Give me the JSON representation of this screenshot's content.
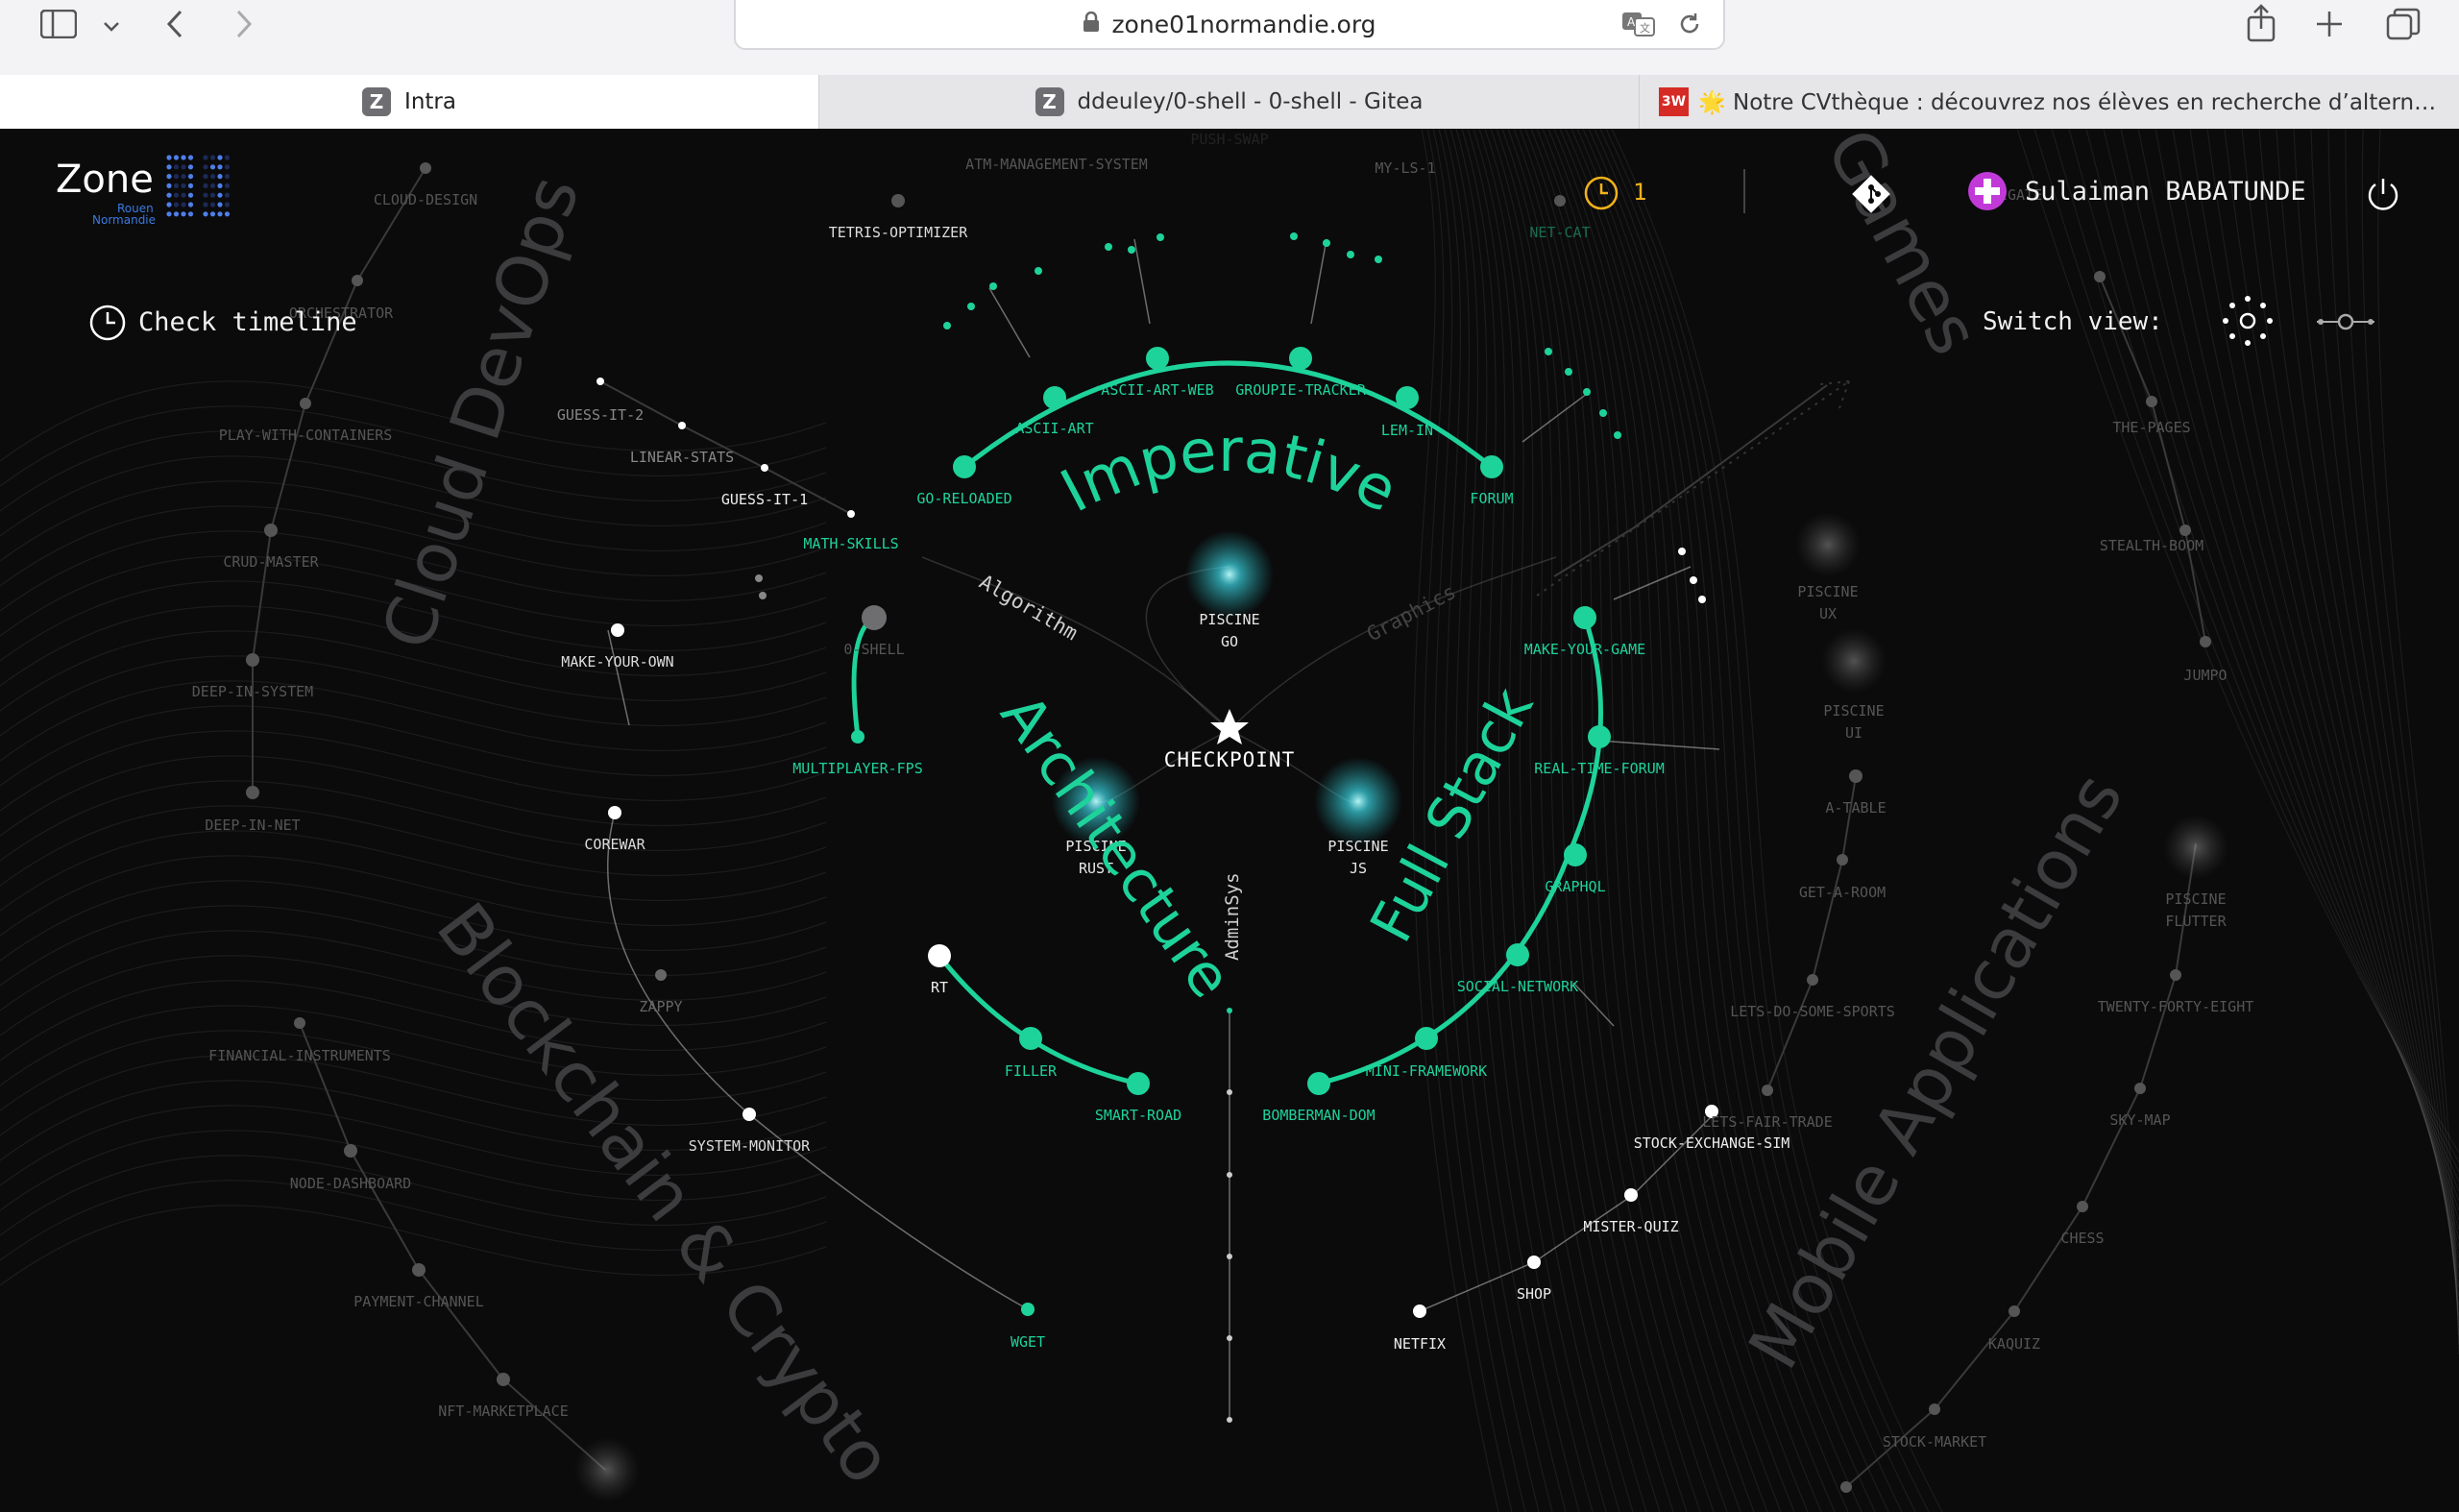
{
  "browser": {
    "url": "zone01normandie.org",
    "tabs": [
      {
        "label": "Intra",
        "favicon": "Z"
      },
      {
        "label": "ddeuley/0-shell - 0-shell - Gitea",
        "favicon": "Z"
      },
      {
        "label": "🌟 Notre CVthèque : découvrez nos élèves en recherche d’alternan...",
        "favicon": "3W"
      }
    ]
  },
  "header": {
    "logo_text": "Zone",
    "logo_sub1": "Rouen",
    "logo_sub2": "Normandie",
    "notification_count": "1",
    "user_name": "Sulaiman BABATUNDE",
    "check_timeline": "Check timeline",
    "switch_view": "Switch view:"
  },
  "colors": {
    "accent": "#1ed39a",
    "background": "#0b0b0c",
    "notification": "#f1b21a",
    "avatar": "#c13ad8"
  },
  "center": {
    "checkpoint": "CHECKPOINT",
    "piscines": [
      {
        "line1": "PISCINE",
        "line2": "GO"
      },
      {
        "line1": "PISCINE",
        "line2": "RUST"
      },
      {
        "line1": "PISCINE",
        "line2": "JS"
      }
    ]
  },
  "branches": [
    {
      "label": "Imperative"
    },
    {
      "label": "Architecture"
    },
    {
      "label": "Full Stack"
    }
  ],
  "sub_branches": [
    "Algorithm",
    "Graphics",
    "AdminSys"
  ],
  "domains": [
    "Cloud DevOps",
    "Blockchain & Crypto",
    "Mobile Applications",
    "Games"
  ],
  "projects": {
    "imperative": [
      "ASCII-ART-WEB",
      "GROUPIE-TRACKER",
      "ASCII-ART",
      "LEM-IN",
      "GO-RELOADED",
      "FORUM"
    ],
    "architecture": [
      "MULTIPLAYER-FPS",
      "RT",
      "FILLER",
      "SMART-ROAD",
      "0-SHELL"
    ],
    "fullstack": [
      "MAKE-YOUR-GAME",
      "REAL-TIME-FORUM",
      "GRAPHQL",
      "SOCIAL-NETWORK",
      "MINI-FRAMEWORK",
      "BOMBERMAN-DOM"
    ],
    "algorithm": [
      "GUESS-IT-1",
      "MATH-SKILLS",
      "LINEAR-STATS",
      "GUESS-IT-2"
    ],
    "left_white": [
      "MAKE-YOUR-OWN",
      "COREWAR",
      "ZAPPY",
      "SYSTEM-MONITOR",
      "WGET"
    ],
    "cloud": [
      "CLOUD-DESIGN",
      "ORCHESTRATOR",
      "PLAY-WITH-CONTAINERS",
      "CRUD-MASTER",
      "DEEP-IN-SYSTEM",
      "DEEP-IN-NET"
    ],
    "blockchain": [
      "FINANCIAL-INSTRUMENTS",
      "NODE-DASHBOARD",
      "PAYMENT-CHANNEL",
      "NFT-MARKETPLACE"
    ],
    "top": [
      "TETRIS-OPTIMIZER",
      "ATM-MANAGEMENT-SYSTEM",
      "MY-LS-1",
      "NET-CAT",
      "PUSH-SWAP"
    ],
    "mobile": [
      "PISCINE UX",
      "PISCINE UI",
      "A-TABLE",
      "GET-A-ROOM",
      "LETS-DO-SOME-SPORTS",
      "LETS-FAIR-TRADE",
      "PISCINE FLUTTER",
      "TWENTY-FORTY-EIGHT",
      "SKY-MAP",
      "CHESS",
      "KAQUIZ",
      "STOCK-MARKET"
    ],
    "right_white": [
      "STOCK-EXCHANGE-SIM",
      "MISTER-QUIZ",
      "SHOP",
      "NETFIX"
    ],
    "games": [
      "THE-PAGES",
      "STEALTH-BOOM",
      "JUMPO",
      "NAVIGATE"
    ]
  }
}
